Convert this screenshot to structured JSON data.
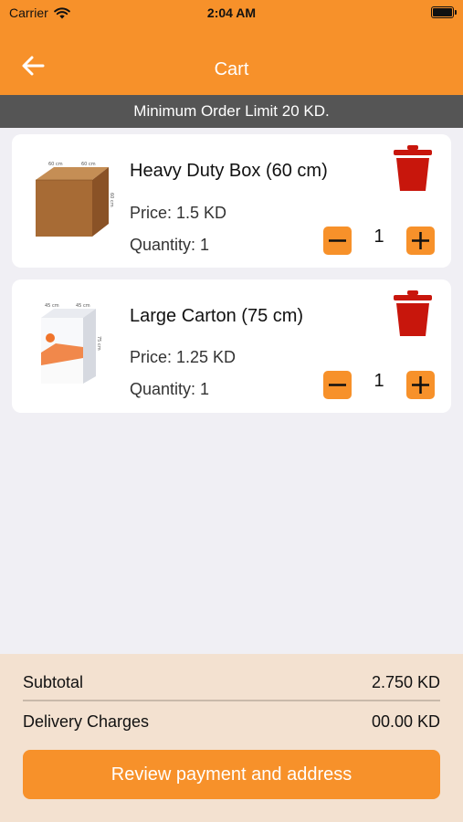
{
  "status_bar": {
    "carrier": "Carrier",
    "time": "2:04 AM"
  },
  "nav": {
    "title": "Cart",
    "back_icon": "arrow-left-icon"
  },
  "banner": {
    "text": "Minimum Order Limit 20 KD."
  },
  "items": [
    {
      "name": "Heavy Duty Box (60 cm)",
      "price": "Price: 1.5 KD",
      "quantity_label": "Quantity: 1",
      "stepper_value": "1",
      "dim_w": "60 cm",
      "dim_d": "60 cm",
      "dim_h": "60 cm"
    },
    {
      "name": "Large Carton (75 cm)",
      "price": "Price: 1.25 KD",
      "quantity_label": "Quantity: 1",
      "stepper_value": "1",
      "dim_w": "45 cm",
      "dim_d": "45 cm",
      "dim_h": "75 cm"
    }
  ],
  "summary": {
    "subtotal_label": "Subtotal",
    "subtotal_value": "2.750 KD",
    "delivery_label": "Delivery Charges",
    "delivery_value": "00.00 KD"
  },
  "cta": {
    "label": "Review payment and address"
  },
  "colors": {
    "accent": "#f7912a",
    "banner": "#555555",
    "trash": "#c8160c",
    "footer_bg": "#f3e1d0"
  }
}
